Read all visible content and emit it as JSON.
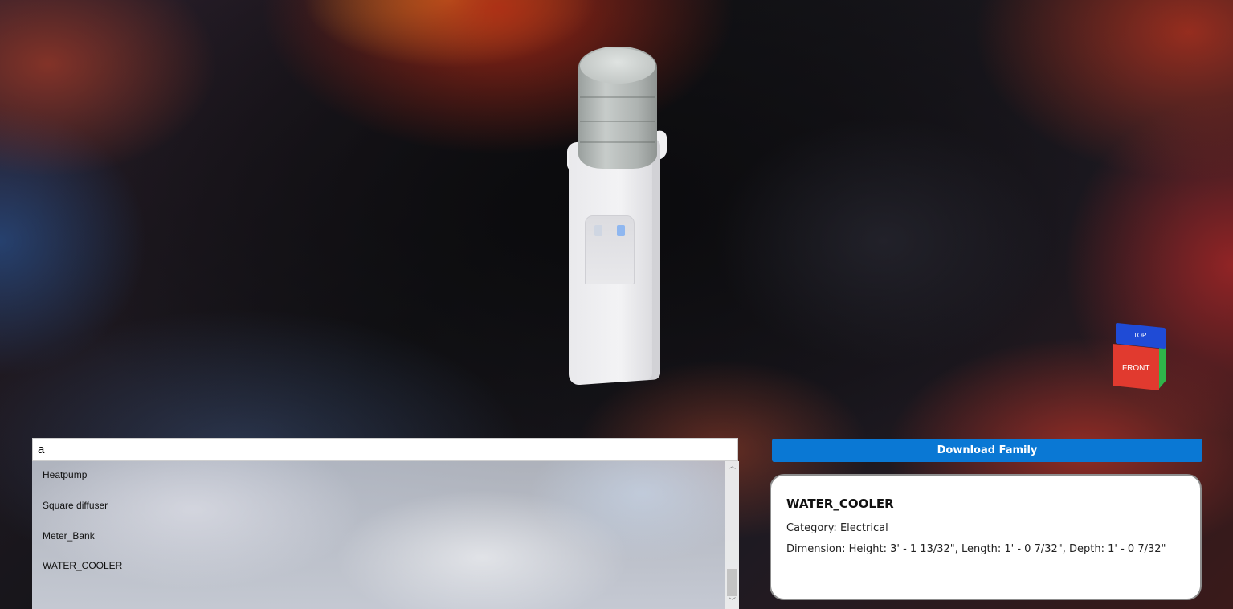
{
  "viewer": {
    "model_name": "water-cooler-3d-model",
    "viewcube": {
      "top_label": "TOP",
      "front_label": "FRONT"
    }
  },
  "search": {
    "value": "a",
    "placeholder": ""
  },
  "results": [
    "Heatpump",
    "Square diffuser",
    "Meter_Bank",
    "WATER_COOLER"
  ],
  "download": {
    "label": "Download Family"
  },
  "details": {
    "title": "WATER_COOLER",
    "category": "Category: Electrical",
    "dimension": "Dimension: Height: 3' - 1 13/32\", Length: 1' - 0 7/32\", Depth: 1' - 0 7/32\""
  },
  "colors": {
    "accent": "#0a78d4",
    "cube_top": "#1f4bd6",
    "cube_front": "#e13a2f",
    "cube_side": "#2fb44a"
  }
}
